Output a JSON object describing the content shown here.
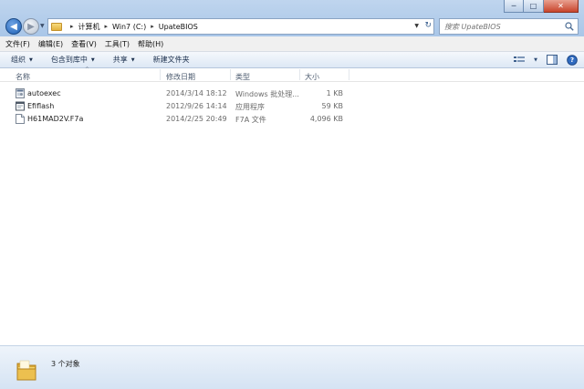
{
  "window": {
    "minimize": "─",
    "maximize": "□",
    "close": "✕"
  },
  "nav": {
    "back": "◀",
    "forward": "▶",
    "history": "▼"
  },
  "address": {
    "crumbs": [
      "计算机",
      "Win7 (C:)",
      "UpateBIOS"
    ],
    "separator": "▸",
    "dropdown": "▼",
    "refresh": "↻"
  },
  "search": {
    "placeholder": "搜索 UpateBIOS"
  },
  "menu": [
    "文件(F)",
    "编辑(E)",
    "查看(V)",
    "工具(T)",
    "帮助(H)"
  ],
  "commands": {
    "organize": "组织",
    "include_in_library": "包含到库中",
    "share": "共享",
    "new_folder": "新建文件夹",
    "arrow": "▼",
    "view_arrow": "▼",
    "help": "?"
  },
  "columns": {
    "name": "名称",
    "modified": "修改日期",
    "type": "类型",
    "size": "大小",
    "sort_caret": "^"
  },
  "files": [
    {
      "name": "autoexec",
      "modified": "2014/3/14 18:12",
      "type": "Windows 批处理...",
      "size": "1 KB",
      "icon": "batch-file-icon"
    },
    {
      "name": "Efiflash",
      "modified": "2012/9/26 14:14",
      "type": "应用程序",
      "size": "59 KB",
      "icon": "application-icon"
    },
    {
      "name": "H61MAD2V.F7a",
      "modified": "2014/2/25 20:49",
      "type": "F7A 文件",
      "size": "4,096 KB",
      "icon": "generic-file-icon"
    }
  ],
  "status": {
    "count": "3 个对象"
  },
  "colors": {
    "chrome": "#c9dcef",
    "folder": "#e8bf52",
    "accent": "#1d5fb3"
  }
}
